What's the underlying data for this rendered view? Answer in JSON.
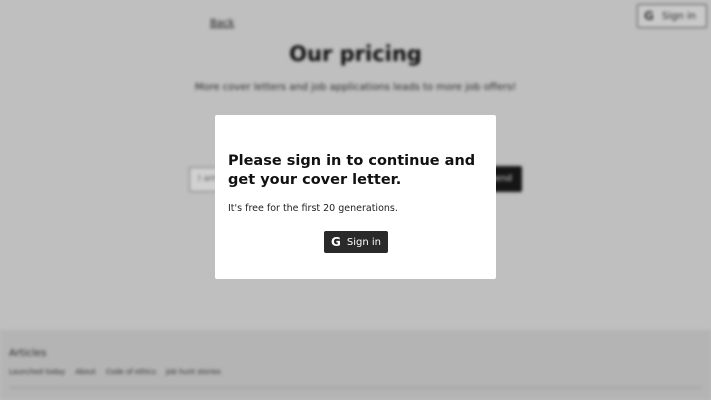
{
  "background": {
    "back_link": "Back",
    "top_signin_label": "Sign in",
    "title": "Our pricing",
    "subtitle": "More cover letters and job applications leads to more job offers!",
    "input_placeholder": "I am",
    "send_label": "Send",
    "footer": {
      "heading": "Articles",
      "links": [
        "Launched today",
        "About",
        "Code of ethics",
        "Job hunt stories"
      ]
    }
  },
  "modal": {
    "title": "Please sign in to continue and get your cover letter.",
    "text": "It's free for the first 20 generations.",
    "signin_label": "Sign in",
    "signin_icon": "google-icon"
  }
}
